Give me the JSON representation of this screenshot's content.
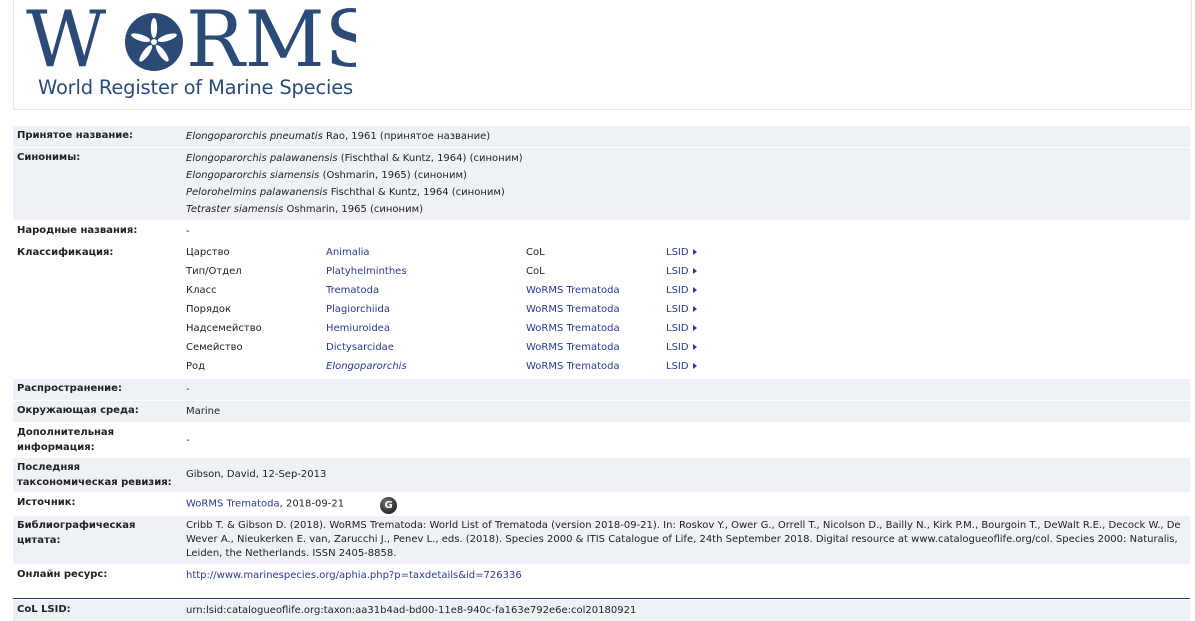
{
  "logo": {
    "title_left": "W",
    "title_right": "RMS",
    "subtitle": "World Register of Marine Species",
    "brand_color": "#2b4a76"
  },
  "labels": {
    "accepted": "Принятое название:",
    "synonyms": "Синонимы:",
    "vernacular": "Народные названия:",
    "classification": "Классификация:",
    "distribution": "Распространение:",
    "environment": "Окружающая среда:",
    "additional_1": "Дополнительная",
    "additional_2": "информация:",
    "revision_1": "Последняя",
    "revision_2": "таксономическая ревизия:",
    "source": "Источник:",
    "citation_1": "Библиографическая",
    "citation_2": "цитата:",
    "online": "Онлайн ресурс:",
    "col_lsid": "CoL LSID:"
  },
  "accepted": {
    "name": "Elongoparorchis pneumatis",
    "rest": " Rao, 1961 (принятое название)"
  },
  "synonyms": [
    {
      "name": "Elongoparorchis palawanensis",
      "rest": " (Fischthal & Kuntz, 1964) (синоним)"
    },
    {
      "name": "Elongoparorchis siamensis",
      "rest": " (Oshmarin, 1965) (синоним)"
    },
    {
      "name": "Pelorohelmins palawanensis",
      "rest": " Fischthal & Kuntz, 1964 (синоним)"
    },
    {
      "name": "Tetraster siamensis",
      "rest": " Oshmarin, 1965 (синоним)"
    }
  ],
  "vernacular": "-",
  "classification": [
    {
      "rank": "Царство",
      "name": "Animalia",
      "source": "CoL",
      "lsid": "LSID"
    },
    {
      "rank": "Тип/Отдел",
      "name": "Platyhelminthes",
      "source": "CoL",
      "lsid": "LSID"
    },
    {
      "rank": "Класс",
      "name": "Trematoda",
      "source": "WoRMS Trematoda",
      "lsid": "LSID"
    },
    {
      "rank": "Порядок",
      "name": "Plagiorchiida",
      "source": "WoRMS Trematoda",
      "lsid": "LSID"
    },
    {
      "rank": "Надсемейство",
      "name": "Hemiuroidea",
      "source": "WoRMS Trematoda",
      "lsid": "LSID"
    },
    {
      "rank": "Семейство",
      "name": "Dictysarcidae",
      "source": "WoRMS Trematoda",
      "lsid": "LSID"
    },
    {
      "rank": "Род",
      "name": "Elongoparorchis",
      "source": "WoRMS Trematoda",
      "lsid": "LSID"
    }
  ],
  "distribution": "-",
  "environment": "Marine",
  "additional": "-",
  "revision": "Gibson, David, 12-Sep-2013",
  "source": {
    "link": "WoRMS Trematoda",
    "date": ", 2018-09-21",
    "icon": "G"
  },
  "citation": "Cribb T. & Gibson D. (2018). WoRMS Trematoda: World List of Trematoda (version 2018-09-21). In: Roskov Y., Ower G., Orrell T., Nicolson D., Bailly N., Kirk P.M., Bourgoin T., DeWalt R.E., Decock W., De Wever A., Nieukerken E. van, Zarucchi J., Penev L., eds. (2018). Species 2000 & ITIS Catalogue of Life, 24th September 2018. Digital resource at www.catalogueoflife.org/col. Species 2000: Naturalis, Leiden, the Netherlands. ISSN 2405-8858.",
  "online": "http://www.marinespecies.org/aphia.php?p=taxdetails&id=726336",
  "col_lsid": "urn:lsid:catalogueoflife.org:taxon:aa31b4ad-bd00-11e8-940c-fa163e792e6e:col20180921"
}
